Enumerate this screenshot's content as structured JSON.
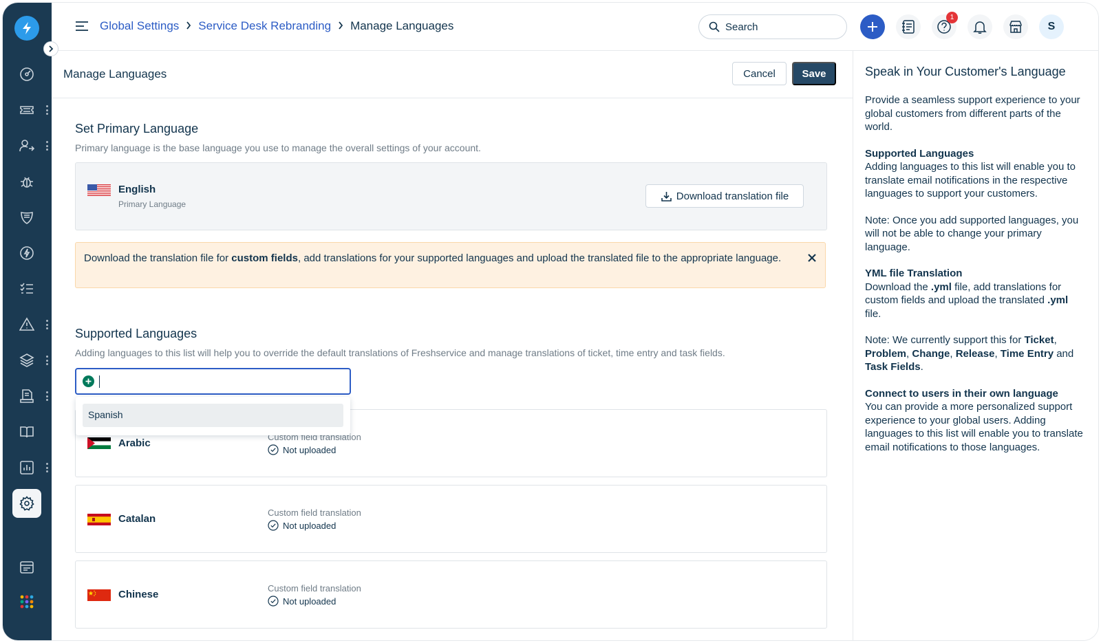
{
  "header": {
    "breadcrumb": [
      "Global Settings",
      "Service Desk Rebranding",
      "Manage Languages"
    ],
    "search_placeholder": "Search",
    "help_badge": "1",
    "avatar_initial": "S"
  },
  "page": {
    "title": "Manage Languages",
    "cancel_label": "Cancel",
    "save_label": "Save"
  },
  "primary": {
    "title": "Set Primary Language",
    "description": "Primary language is the base language you use to manage the overall settings of your account.",
    "language": "English",
    "sub_label": "Primary Language",
    "download_label": "Download translation file"
  },
  "alert": {
    "text_before": "Download the translation file for ",
    "text_bold": "custom fields",
    "text_after": ", add translations for your supported languages and upload the translated file to the appropriate language."
  },
  "supported": {
    "title": "Supported Languages",
    "description": "Adding languages to this list will help you to override the default translations of Freshservice and manage translations of ticket, time entry and task fields.",
    "input_value": "",
    "dropdown_option": "Spanish",
    "languages": [
      {
        "name": "Arabic",
        "field_label": "Custom field translation",
        "status": "Not uploaded"
      },
      {
        "name": "Catalan",
        "field_label": "Custom field translation",
        "status": "Not uploaded"
      },
      {
        "name": "Chinese",
        "field_label": "Custom field translation",
        "status": "Not uploaded"
      }
    ]
  },
  "right_panel": {
    "title": "Speak in Your Customer's Language",
    "intro": "Provide a seamless support experience to your global customers from different parts of the world.",
    "supported_head": "Supported Languages",
    "supported_body": "Adding languages to this list will enable you to translate email notifications in the respective languages to support your customers.",
    "note1": "Note: Once you add supported languages, you will not be able to change your primary language.",
    "yml_head": "YML file Translation",
    "yml_1": "Download the ",
    "yml_b1": ".yml",
    "yml_2": " file, add translations for custom fields and upload the translated ",
    "yml_b2": ".yml",
    "yml_3": " file.",
    "note2_1": "Note: We currently support this for ",
    "note2_b1": "Ticket",
    "note2_s1": ", ",
    "note2_b2": "Problem",
    "note2_s2": ", ",
    "note2_b3": "Change",
    "note2_s3": ", ",
    "note2_b4": "Release",
    "note2_s4": ", ",
    "note2_b5": "Time Entry",
    "note2_s5": " and ",
    "note2_b6": "Task Fields",
    "note2_end": ".",
    "connect_head": "Connect to users in their own language",
    "connect_body": "You can provide a more personalized support experience to your global users. Adding languages to this list will enable you to translate email notifications to those languages."
  },
  "colors": {
    "sidebar_bg": "#1b3a52",
    "link_blue": "#2c5cc5",
    "primary_button": "#264966",
    "alert_bg": "#fef1e1",
    "alert_border": "#fad7a9"
  }
}
